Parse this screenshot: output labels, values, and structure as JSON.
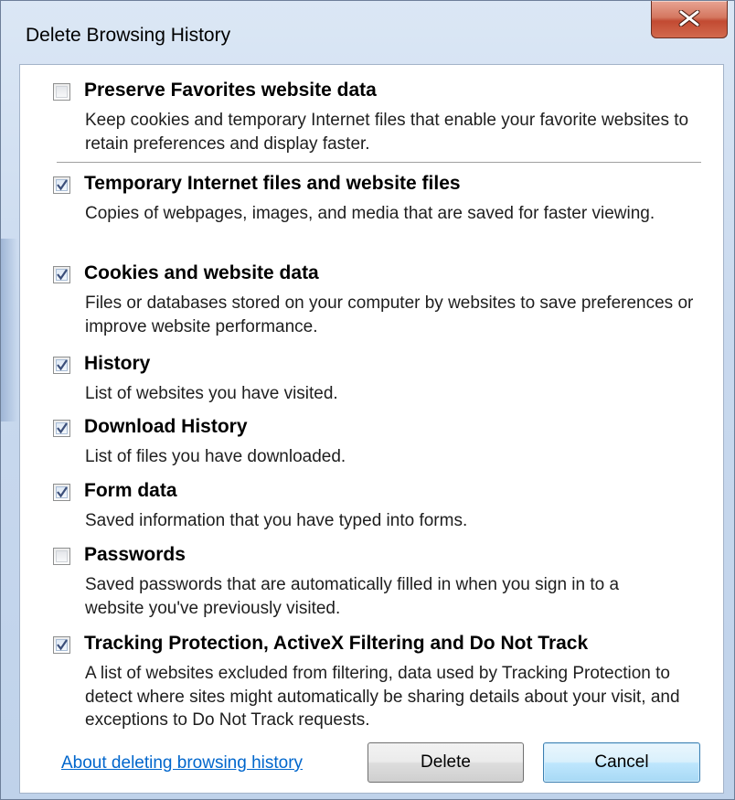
{
  "window": {
    "title": "Delete Browsing History",
    "close_label": "X"
  },
  "options": [
    {
      "title": "Preserve Favorites website data",
      "desc": "Keep cookies and temporary Internet files that enable your favorite websites to retain preferences and display faster.",
      "checked": false
    },
    {
      "title": "Temporary Internet files and website files",
      "desc": "Copies of webpages, images, and media that are saved for faster viewing.",
      "checked": true
    },
    {
      "title": "Cookies and website data",
      "desc": "Files or databases stored on your computer by websites to save preferences or improve website performance.",
      "checked": true
    },
    {
      "title": "History",
      "desc": "List of websites you have visited.",
      "checked": true
    },
    {
      "title": "Download History",
      "desc": "List of files you have downloaded.",
      "checked": true
    },
    {
      "title": "Form data",
      "desc": "Saved information that you have typed into forms.",
      "checked": true
    },
    {
      "title": "Passwords",
      "desc": "Saved passwords that are automatically filled in when you sign in to a website you've previously visited.",
      "checked": false
    },
    {
      "title": "Tracking Protection, ActiveX Filtering and Do Not Track",
      "desc": "A list of websites excluded from filtering, data used by Tracking Protection to detect where sites might automatically be sharing details about your visit, and exceptions to Do Not Track requests.",
      "checked": true
    }
  ],
  "footer": {
    "about_link": "About deleting browsing history",
    "delete_label": "Delete",
    "cancel_label": "Cancel"
  },
  "colors": {
    "link": "#0066cc",
    "close_button": "#c24a32",
    "default_button_border": "#3c7fb1"
  }
}
